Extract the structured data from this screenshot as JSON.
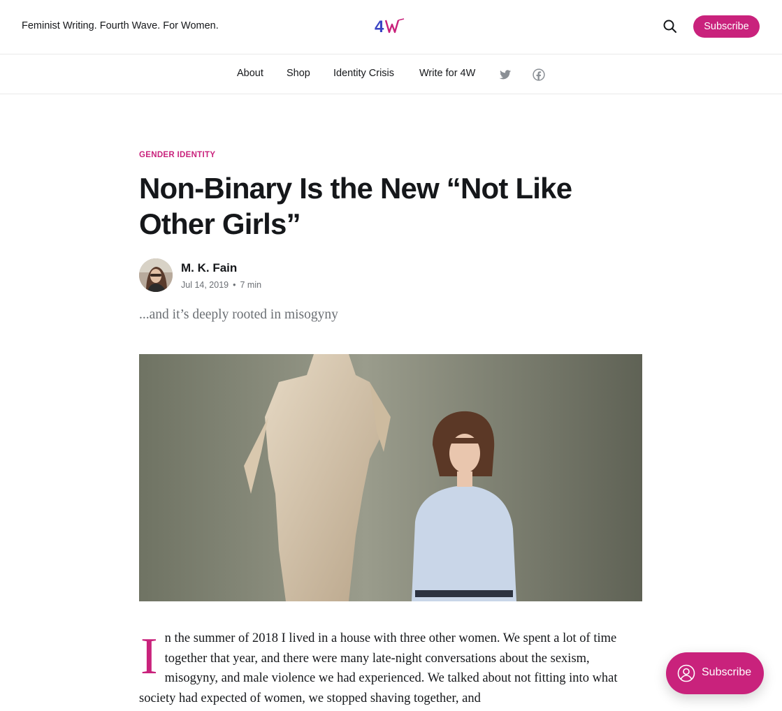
{
  "header": {
    "tagline": "Feminist Writing. Fourth Wave. For Women.",
    "logo_text": "4W",
    "subscribe_label": "Subscribe"
  },
  "nav": {
    "items": [
      "About",
      "Shop",
      "Identity Crisis",
      "Write for 4W"
    ],
    "social_icons": [
      "twitter-icon",
      "facebook-icon"
    ]
  },
  "article": {
    "category": "Gender Identity",
    "title": "Non-Binary Is the New “Not Like Other Girls”",
    "author": "M. K. Fain",
    "date": "Jul 14, 2019",
    "separator": "•",
    "reading_time": "7 min",
    "excerpt": "...and it’s deeply rooted in misogyny",
    "dropcap": "I",
    "body_start": "n the summer of 2018 I lived in a house with three other women. We spent a lot of time together that year, and there were many late-night conversations about the sexism, misogyny, and male violence we had experienced. We talked about not fitting into what society had expected of women, we stopped shaving together, and"
  },
  "portal": {
    "label": "Subscribe"
  },
  "colors": {
    "accent": "#c9227c",
    "text": "#15171a",
    "muted": "#6b6f74"
  }
}
